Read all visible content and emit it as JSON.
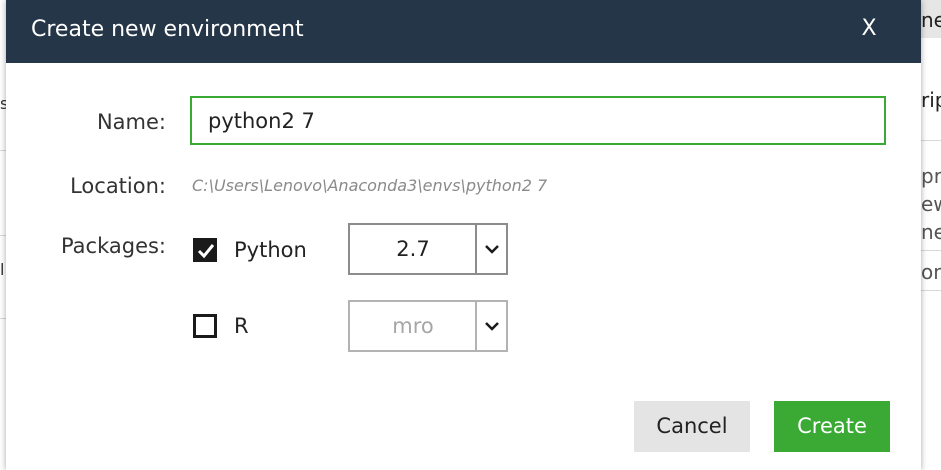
{
  "dialog": {
    "title": "Create new environment",
    "close_label": "X",
    "name_label": "Name:",
    "name_value": "python2 7",
    "location_label": "Location:",
    "location_path": "C:\\Users\\Lenovo\\Anaconda3\\envs\\python2 7",
    "packages_label": "Packages:",
    "packages": [
      {
        "name": "Python",
        "checked": true,
        "version": "2.7",
        "enabled": true
      },
      {
        "name": "R",
        "checked": false,
        "version": "mro",
        "enabled": false
      }
    ],
    "cancel_label": "Cancel",
    "create_label": "Create"
  },
  "background": {
    "right_fragments": [
      "ne",
      "rip",
      "pre",
      "ew",
      "ne",
      "on"
    ],
    "left_fragments": [
      "s",
      "l"
    ]
  },
  "colors": {
    "titlebar": "#253648",
    "accent_green": "#3aaa35",
    "cancel_bg": "#e4e4e4"
  }
}
